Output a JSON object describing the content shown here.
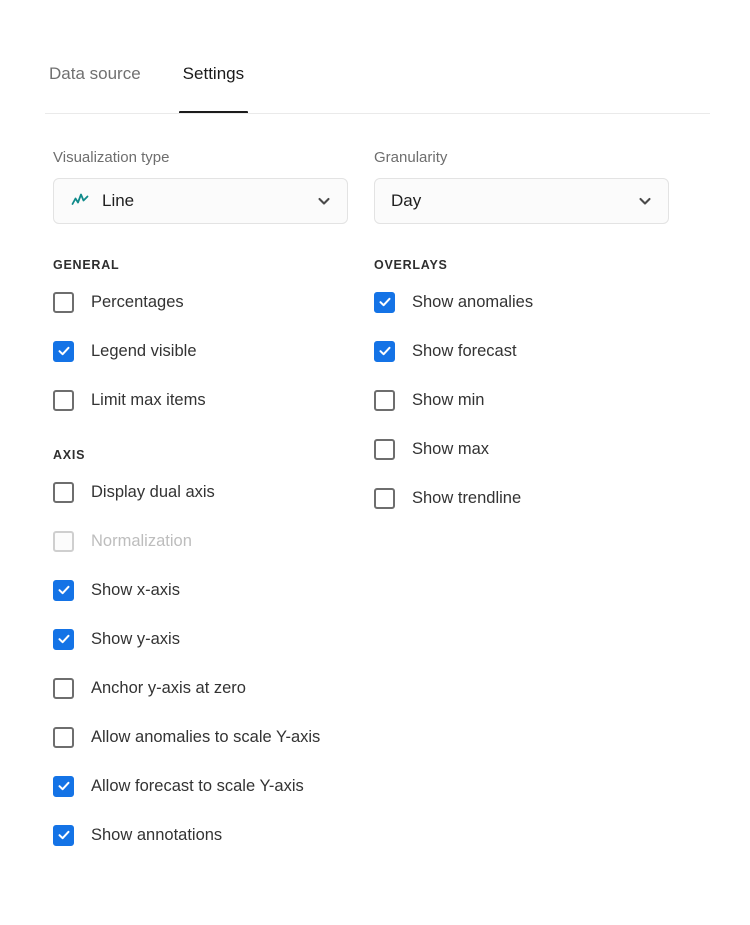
{
  "tabs": [
    {
      "label": "Data source",
      "active": false
    },
    {
      "label": "Settings",
      "active": true
    }
  ],
  "fields": {
    "visualization_type": {
      "label": "Visualization type",
      "value": "Line",
      "icon": "line-chart-icon",
      "icon_color": "#0f8a8a",
      "chevron": "chevron-down-icon"
    },
    "granularity": {
      "label": "Granularity",
      "value": "Day",
      "chevron": "chevron-down-icon"
    }
  },
  "sections": {
    "general": {
      "title": "GENERAL",
      "items": [
        {
          "label": "Percentages",
          "checked": false,
          "disabled": false
        },
        {
          "label": "Legend visible",
          "checked": true,
          "disabled": false
        },
        {
          "label": "Limit max items",
          "checked": false,
          "disabled": false
        }
      ]
    },
    "axis": {
      "title": "AXIS",
      "items": [
        {
          "label": "Display dual axis",
          "checked": false,
          "disabled": false
        },
        {
          "label": "Normalization",
          "checked": false,
          "disabled": true
        },
        {
          "label": "Show x-axis",
          "checked": true,
          "disabled": false
        },
        {
          "label": "Show y-axis",
          "checked": true,
          "disabled": false
        },
        {
          "label": "Anchor y-axis at zero",
          "checked": false,
          "disabled": false
        },
        {
          "label": "Allow anomalies to scale Y-axis",
          "checked": false,
          "disabled": false
        },
        {
          "label": "Allow forecast to scale Y-axis",
          "checked": true,
          "disabled": false
        },
        {
          "label": "Show annotations",
          "checked": true,
          "disabled": false
        }
      ]
    },
    "overlays": {
      "title": "OVERLAYS",
      "items": [
        {
          "label": "Show anomalies",
          "checked": true,
          "disabled": false
        },
        {
          "label": "Show forecast",
          "checked": true,
          "disabled": false
        },
        {
          "label": "Show min",
          "checked": false,
          "disabled": false
        },
        {
          "label": "Show max",
          "checked": false,
          "disabled": false
        },
        {
          "label": "Show trendline",
          "checked": false,
          "disabled": false
        }
      ]
    }
  },
  "colors": {
    "accent_checked": "#1473e6",
    "tab_active": "#1b1b1b",
    "tab_inactive": "#707070",
    "viz_icon": "#0f8a8a",
    "disabled_text": "#bdbdbd"
  }
}
